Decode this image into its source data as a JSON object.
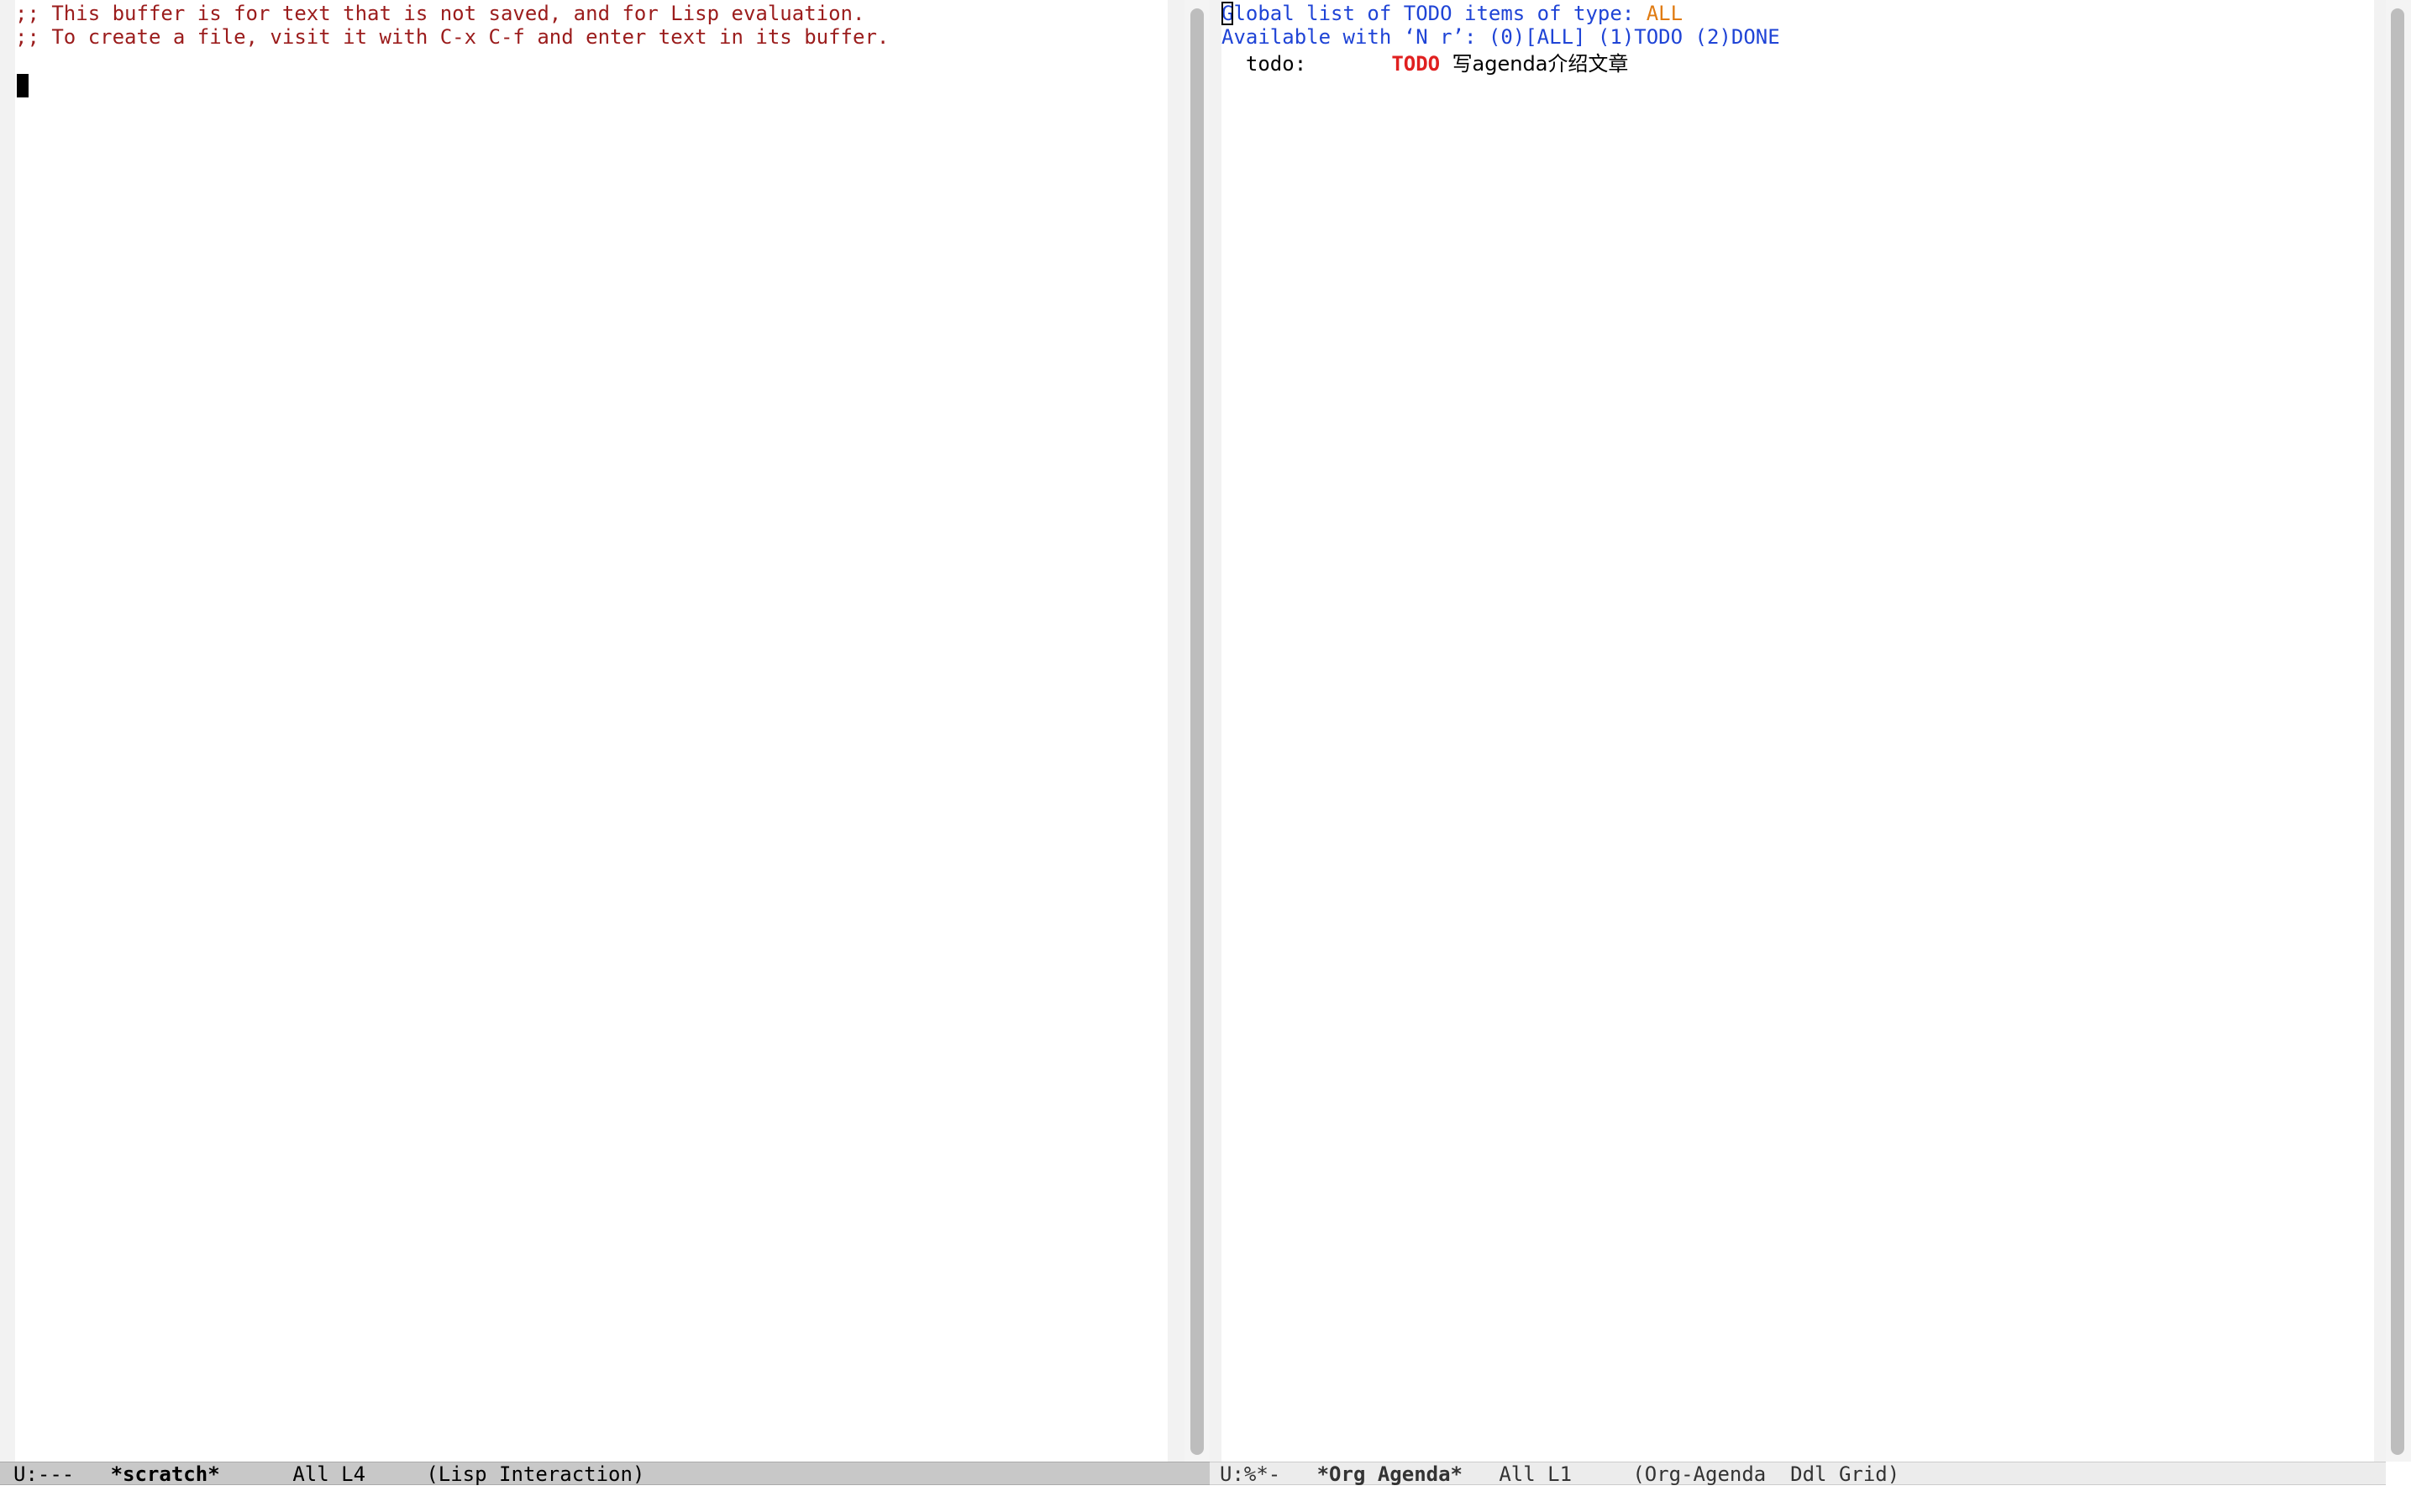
{
  "left_window": {
    "lines": [
      ";; This buffer is for text that is not saved, and for Lisp evaluation.",
      ";; To create a file, visit it with C-x C-f and enter text in its buffer."
    ],
    "modeline": {
      "status": "U:---",
      "buffer_name": "*scratch*",
      "position": "All L4",
      "mode": "(Lisp Interaction)"
    }
  },
  "right_window": {
    "header_line_1": {
      "first_char": "G",
      "rest": "lobal list of TODO items of type: ",
      "type": "ALL"
    },
    "header_line_2": "Available with ‘N r’: (0)[ALL] (1)TODO (2)DONE",
    "items": [
      {
        "category": "todo:",
        "keyword": "TODO",
        "title": "写agenda介绍文章"
      }
    ],
    "modeline": {
      "status": "U:%*-",
      "buffer_name": "*Org Agenda*",
      "position": "All L1",
      "mode": "(Org-Agenda  Ddl Grid)"
    }
  },
  "colors": {
    "comment": "#9b1c1c",
    "agenda_header": "#1f44d6",
    "agenda_type_highlight": "#e07b12",
    "todo_keyword": "#e02020",
    "active_modeline_bg": "#c8c8c8",
    "inactive_modeline_bg": "#ececec"
  }
}
